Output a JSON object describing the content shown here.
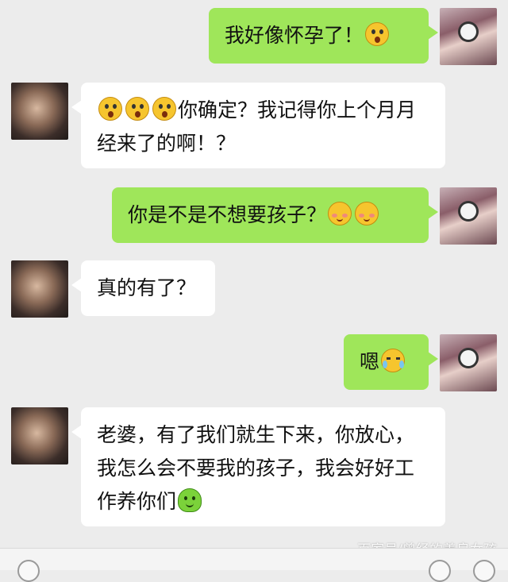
{
  "messages": [
    {
      "from": "me",
      "text": "我好像怀孕了！"
    },
    {
      "from": "you",
      "text": "你确定？我记得你上个月月经来了的啊！？"
    },
    {
      "from": "me",
      "text": "你是不是不想要孩子？"
    },
    {
      "from": "you",
      "text": "真的有了？"
    },
    {
      "from": "me",
      "text": "嗯"
    },
    {
      "from": "you",
      "text": "老婆，有了我们就生下来，你放心，我怎么会不要我的孩子，我会好好工作养你们"
    }
  ],
  "watermark": "百家号/曾经的善良女孩",
  "icons": {
    "msg1": [
      "shocked-emoji-icon"
    ],
    "msg2": [
      "shocked-emoji-icon",
      "shocked-emoji-icon",
      "shocked-emoji-icon"
    ],
    "msg3": [
      "blush-emoji-icon",
      "blush-emoji-icon"
    ],
    "msg5": [
      "crying-emoji-icon"
    ],
    "msg6": [
      "green-character-emoji-icon"
    ]
  },
  "colors": {
    "sent_bubble": "#9fe65a",
    "received_bubble": "#ffffff",
    "background": "#ececec"
  }
}
